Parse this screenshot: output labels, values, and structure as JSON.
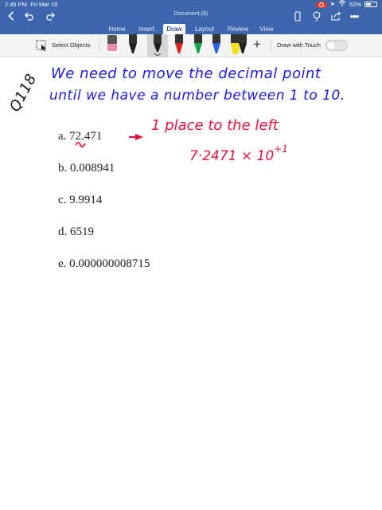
{
  "status_bar": {
    "time": "2:45 PM",
    "date": "Fri Mar 19",
    "battery": "52%"
  },
  "title_bar": {
    "document_title": "Document (6)"
  },
  "tabs": [
    "Home",
    "Insert",
    "Draw",
    "Layout",
    "Review",
    "View"
  ],
  "active_tab": "Draw",
  "ribbon": {
    "select_objects": "Select Objects",
    "draw_with_touch": "Draw with Touch",
    "draw_with_touch_on": false,
    "pen_colors": [
      "#1f1f1f",
      "#1f1f1f",
      "#e0201a",
      "#16a34a",
      "#2563eb",
      "#f5e11a",
      "#1f1f1f"
    ]
  },
  "document": {
    "question_label": "Q118",
    "note_line1": "We need to move the decimal point",
    "note_line2": "until we have a number between 1 to 10.",
    "options": [
      {
        "letter": "a.",
        "value": "72.471"
      },
      {
        "letter": "b.",
        "value": "0.008941"
      },
      {
        "letter": "c.",
        "value": "9.9914"
      },
      {
        "letter": "d.",
        "value": "6519"
      },
      {
        "letter": "e.",
        "value": "0.000000008715"
      }
    ],
    "annotation_place": "1 place to the left",
    "annotation_result": "7·2471 × 10",
    "annotation_exponent": "+1"
  },
  "colors": {
    "chrome_blue": "#3d66ad",
    "ink_blue": "#1a1ae8",
    "ink_red": "#e8123a"
  }
}
